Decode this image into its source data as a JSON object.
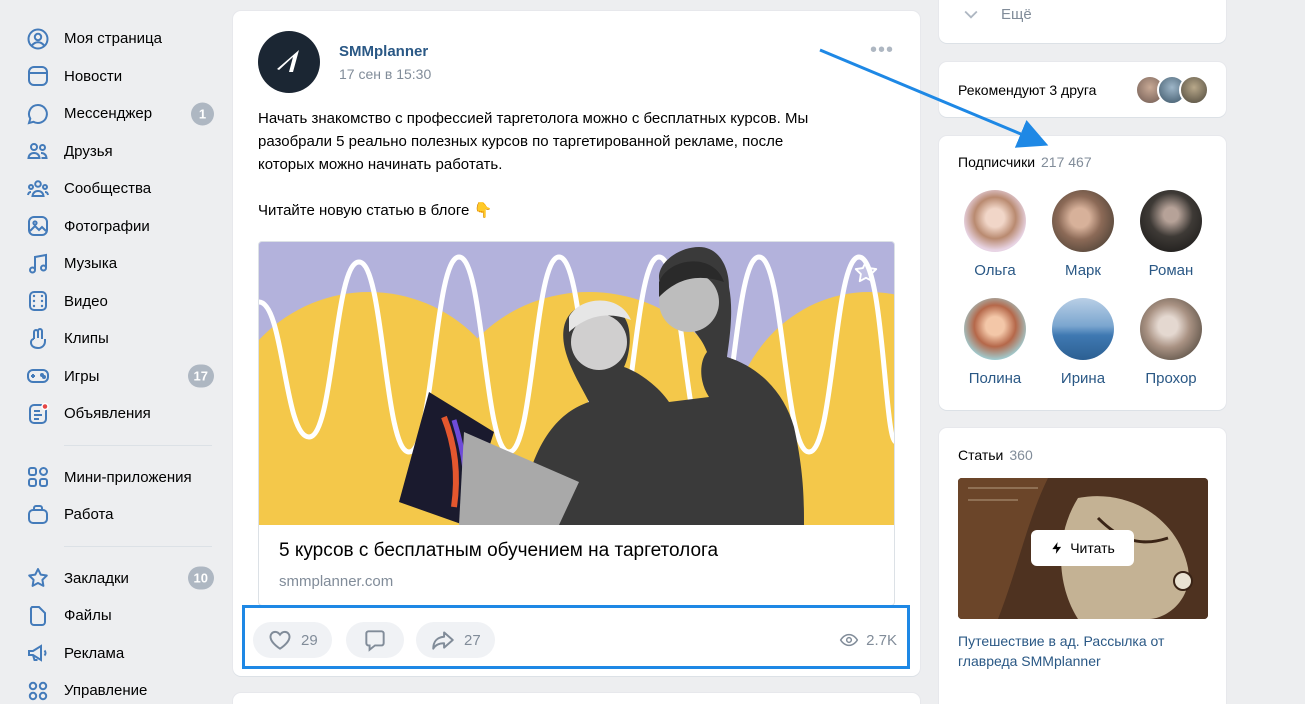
{
  "sidebar": {
    "items": [
      {
        "label": "Моя страница",
        "icon": "user-circle-icon"
      },
      {
        "label": "Новости",
        "icon": "news-icon"
      },
      {
        "label": "Мессенджер",
        "icon": "message-icon",
        "badge": "1"
      },
      {
        "label": "Друзья",
        "icon": "friends-icon"
      },
      {
        "label": "Сообщества",
        "icon": "communities-icon"
      },
      {
        "label": "Фотографии",
        "icon": "photo-icon"
      },
      {
        "label": "Музыка",
        "icon": "music-icon"
      },
      {
        "label": "Видео",
        "icon": "video-icon"
      },
      {
        "label": "Клипы",
        "icon": "clips-icon"
      },
      {
        "label": "Игры",
        "icon": "gamepad-icon",
        "badge": "17"
      },
      {
        "label": "Объявления",
        "icon": "ads-board-icon"
      },
      {
        "label": "Мини-приложения",
        "icon": "mini-apps-icon"
      },
      {
        "label": "Работа",
        "icon": "briefcase-icon"
      },
      {
        "label": "Закладки",
        "icon": "star-icon",
        "badge": "10"
      },
      {
        "label": "Файлы",
        "icon": "file-icon"
      },
      {
        "label": "Реклама",
        "icon": "megaphone-icon"
      },
      {
        "label": "Управление",
        "icon": "manage-icon"
      }
    ]
  },
  "post": {
    "author": "SMMplanner",
    "date": "17 сен в 15:30",
    "text_line1": "Начать знакомство с профессией таргетолога можно с бесплатных курсов. Мы",
    "text_line2": "разобрали 5 реально полезных курсов по таргетированной рекламе, после",
    "text_line3": "которых можно начинать работать.",
    "text_line4": "Читайте новую статью в блоге 👇",
    "link": {
      "title": "5 курсов с бесплатным обучением на таргетолога",
      "domain": "smmplanner.com"
    },
    "likes": "29",
    "shares": "27",
    "views": "2.7K"
  },
  "right": {
    "more_label": "Ещё",
    "recommend_label": "Рекомендуют 3 друга",
    "subscribers": {
      "title": "Подписчики",
      "count": "217 467",
      "people": [
        "Ольга",
        "Марк",
        "Роман",
        "Полина",
        "Ирина",
        "Прохор"
      ]
    },
    "articles": {
      "title": "Статьи",
      "count": "360",
      "read_label": "Читать",
      "article_title": "Путешествие в ад. Рассылка от главреда SMMplanner"
    }
  },
  "colors": {
    "accent": "#2a5885",
    "highlight_frame": "#1e88e5",
    "badge": "#aeb7c2"
  }
}
